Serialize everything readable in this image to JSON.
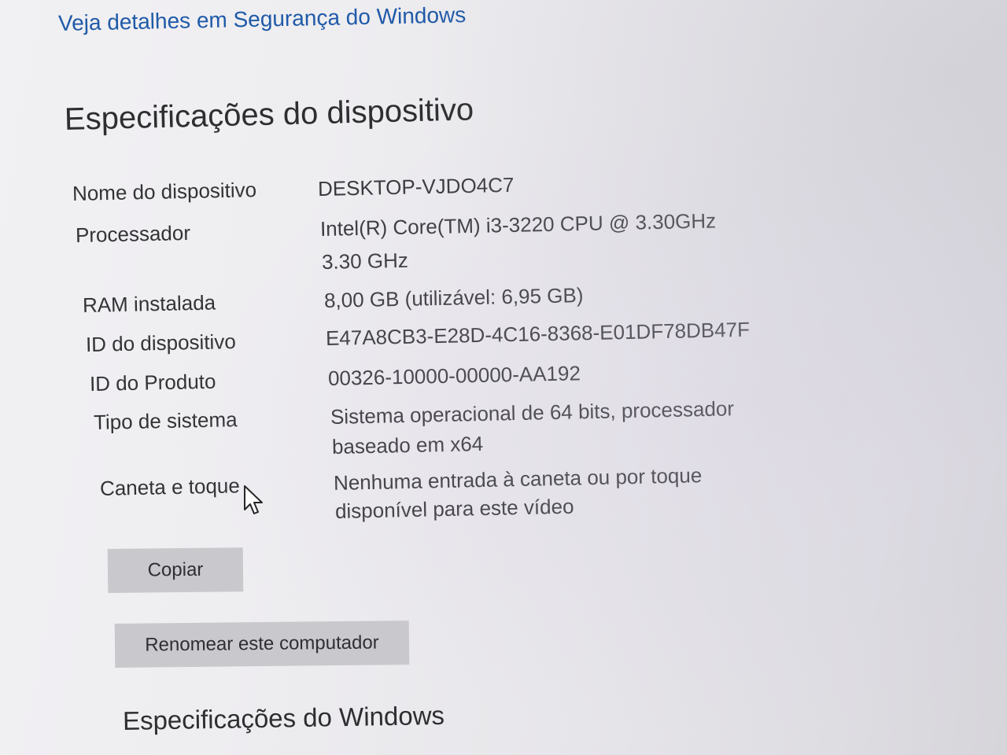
{
  "security_link": "Veja detalhes em Segurança do Windows",
  "device_specs": {
    "title": "Especificações do dispositivo",
    "rows": [
      {
        "label": "Nome do dispositivo",
        "value": "DESKTOP-VJDO4C7"
      },
      {
        "label": "Processador",
        "value": "Intel(R) Core(TM) i3-3220 CPU @ 3.30GHz",
        "value2": "3.30 GHz"
      },
      {
        "label": "RAM instalada",
        "value": "8,00 GB (utilizável: 6,95 GB)"
      },
      {
        "label": "ID do dispositivo",
        "value": "E47A8CB3-E28D-4C16-8368-E01DF78DB47F"
      },
      {
        "label": "ID do Produto",
        "value": "00326-10000-00000-AA192"
      },
      {
        "label": "Tipo de sistema",
        "value": "Sistema operacional de 64 bits, processador",
        "value2": "baseado em x64"
      },
      {
        "label": "Caneta e toque",
        "value": "Nenhuma entrada à caneta ou por toque",
        "value2": "disponível para este vídeo"
      }
    ]
  },
  "buttons": {
    "copy_label": "Copiar",
    "rename_label": "Renomear este computador"
  },
  "windows_specs": {
    "title": "Especificações do Windows"
  },
  "colors": {
    "link": "#1f5aa8",
    "button_bg": "#c9c8cc",
    "text": "#333336"
  },
  "icons": {
    "cursor": "mouse-pointer-icon"
  }
}
